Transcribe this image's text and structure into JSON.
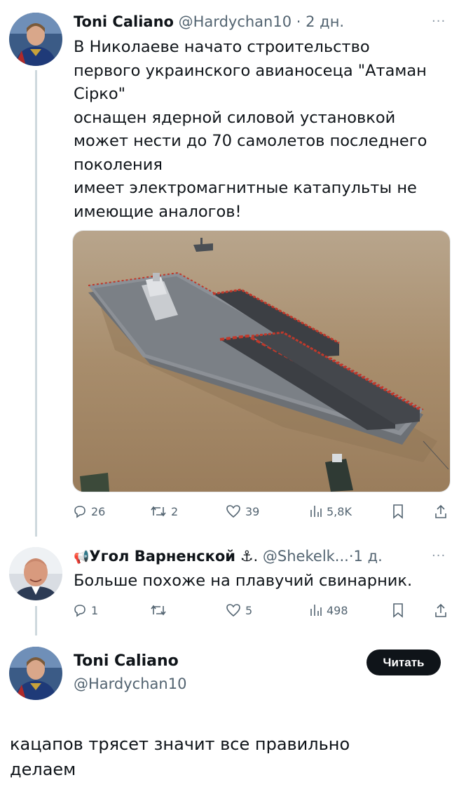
{
  "tweet": {
    "author_name": "Toni Caliano",
    "handle": "@Hardychan10",
    "separator": "·",
    "time": "2 дн.",
    "more": "···",
    "lines": [
      "В Николаеве начато строительство",
      "первого украинского авианосеца \"Атаман",
      "Сірко\"",
      "оснащен ядерной силовой установкой",
      "может нести до 70 самолетов последнего",
      "поколения",
      "имеет электромагнитные катапульты не",
      "имеющие аналогов!"
    ],
    "image_alt": "aircraft-carrier-photo",
    "replies": "26",
    "reposts": "2",
    "likes": "39",
    "views": "5,8K"
  },
  "reply": {
    "author_name": "Угол Варненской",
    "emoji_prefix": "📢",
    "symbol_suffix": "⚓.",
    "handle": "@Shekelk...",
    "separator": "·",
    "time": "1 д.",
    "more": "···",
    "text": "Больше похоже на плавучий свинарник.",
    "replies": "1",
    "reposts": "",
    "likes": "5",
    "views": "498"
  },
  "profile_card": {
    "author_name": "Toni Caliano",
    "handle": "@Hardychan10",
    "follow_label": "Читать"
  },
  "caption": {
    "lines": [
      "кацапов трясет значит все правильно",
      "делаем"
    ]
  },
  "colors": {
    "text": "#0f1419",
    "muted": "#536471",
    "thread_line": "#cfd9de",
    "button_bg": "#0f1419",
    "water": "#a4896a"
  }
}
